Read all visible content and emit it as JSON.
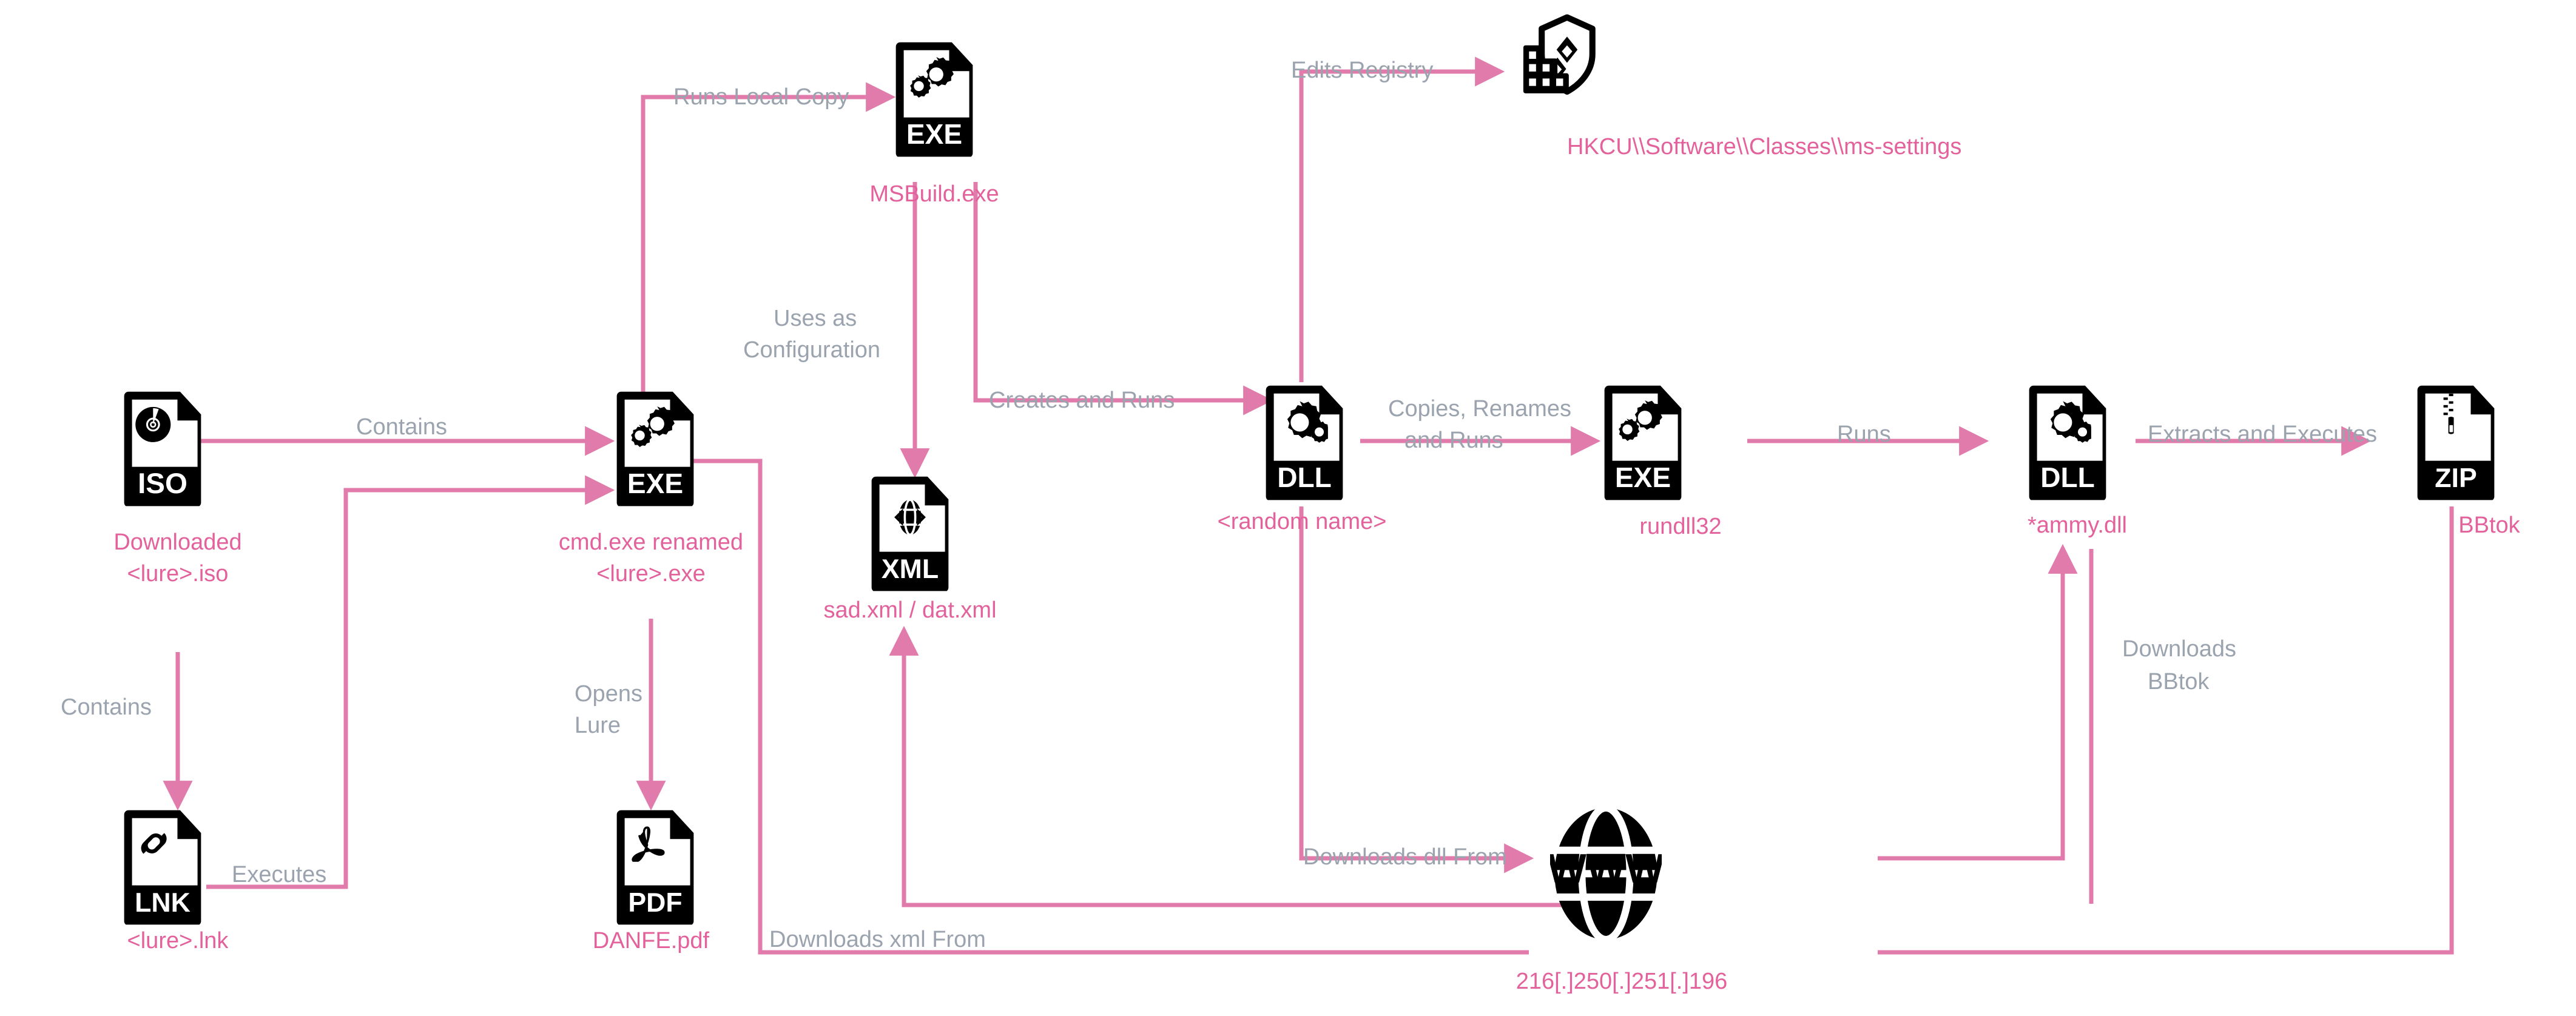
{
  "diagram": {
    "title": "Malware Infection Chain",
    "colors": {
      "connector": "#e07bab",
      "node_label": "#e3629b",
      "edge_label": "#9aa3ae",
      "icon": "#000000",
      "background": "#ffffff"
    }
  },
  "nodes": [
    {
      "id": "iso",
      "icon": "iso-file-icon",
      "icon_ext": "ISO",
      "label_line1": "Downloaded",
      "label_line2": "<lure>.iso"
    },
    {
      "id": "lnk",
      "icon": "lnk-file-icon",
      "icon_ext": "LNK",
      "label_line1": "<lure>.lnk",
      "label_line2": ""
    },
    {
      "id": "cmd_exe",
      "icon": "exe-file-icon",
      "icon_ext": "EXE",
      "label_line1": "cmd.exe renamed",
      "label_line2": "<lure>.exe"
    },
    {
      "id": "pdf",
      "icon": "pdf-file-icon",
      "icon_ext": "PDF",
      "label_line1": "DANFE.pdf",
      "label_line2": ""
    },
    {
      "id": "msbuild",
      "icon": "exe-file-icon",
      "icon_ext": "EXE",
      "label_line1": "MSBuild.exe",
      "label_line2": ""
    },
    {
      "id": "xml",
      "icon": "xml-file-icon",
      "icon_ext": "XML",
      "label_line1": "sad.xml / dat.xml",
      "label_line2": ""
    },
    {
      "id": "random_dll",
      "icon": "dll-file-icon",
      "icon_ext": "DLL",
      "label_line1": "<random name>",
      "label_line2": ""
    },
    {
      "id": "registry",
      "icon": "registry-shield-icon",
      "icon_ext": "",
      "label_line1": "HKCU\\\\Software\\\\Classes\\\\ms-settings",
      "label_line2": ""
    },
    {
      "id": "rundll32",
      "icon": "exe-file-icon",
      "icon_ext": "EXE",
      "label_line1": "rundll32",
      "label_line2": ""
    },
    {
      "id": "ammy_dll",
      "icon": "dll-file-icon",
      "icon_ext": "DLL",
      "label_line1": "*ammy.dll",
      "label_line2": ""
    },
    {
      "id": "bbtok_zip",
      "icon": "zip-file-icon",
      "icon_ext": "ZIP",
      "label_line1": "BBtok",
      "label_line2": ""
    },
    {
      "id": "web",
      "icon": "www-globe-icon",
      "icon_ext": "WWW",
      "label_line1": "216[.]250[.]251[.]196",
      "label_line2": ""
    }
  ],
  "edges": [
    {
      "id": "e_iso_exe",
      "from": "iso",
      "to": "cmd_exe",
      "label": "Contains"
    },
    {
      "id": "e_iso_lnk",
      "from": "iso",
      "to": "lnk",
      "label": "Contains"
    },
    {
      "id": "e_lnk_exe",
      "from": "lnk",
      "to": "cmd_exe",
      "label": "Executes"
    },
    {
      "id": "e_exe_pdf",
      "from": "cmd_exe",
      "to": "pdf",
      "label_line1": "Opens",
      "label_line2": "Lure"
    },
    {
      "id": "e_exe_msbuild",
      "from": "cmd_exe",
      "to": "msbuild",
      "label": "Runs Local Copy"
    },
    {
      "id": "e_msbuild_xml",
      "from": "msbuild",
      "to": "xml",
      "label_line1": "Uses as",
      "label_line2": "Configuration"
    },
    {
      "id": "e_msbuild_dll",
      "from": "msbuild",
      "to": "random_dll",
      "label": "Creates and Runs"
    },
    {
      "id": "e_dll_registry",
      "from": "random_dll",
      "to": "registry",
      "label": "Edits Registry"
    },
    {
      "id": "e_dll_rundll32",
      "from": "random_dll",
      "to": "rundll32",
      "label_line1": "Copies, Renames",
      "label_line2": "and Runs"
    },
    {
      "id": "e_rundll32_ammy",
      "from": "rundll32",
      "to": "ammy_dll",
      "label": "Runs"
    },
    {
      "id": "e_ammy_zip",
      "from": "ammy_dll",
      "to": "bbtok_zip",
      "label": "Extracts and Executes"
    },
    {
      "id": "e_web_dll",
      "from": "web",
      "to": "random_dll",
      "label": "Downloads dll From"
    },
    {
      "id": "e_web_xml",
      "from": "web",
      "to": "xml",
      "label": "Downloads xml From"
    },
    {
      "id": "e_web_ammy",
      "from": "web",
      "to": "ammy_dll",
      "label_line1": "Downloads",
      "label_line2": "BBtok"
    }
  ]
}
